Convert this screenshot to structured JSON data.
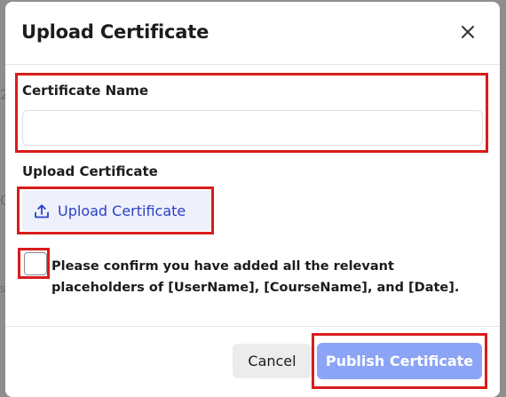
{
  "background": {
    "glyphs": [
      "2",
      "C",
      "s"
    ]
  },
  "modal": {
    "title": "Upload Certificate",
    "close_icon": "close-icon"
  },
  "form": {
    "certificate_name": {
      "label": "Certificate Name",
      "value": "",
      "placeholder": ""
    },
    "upload": {
      "label": "Upload Certificate",
      "button_label": "Upload Certificate",
      "icon": "upload-icon"
    },
    "confirm": {
      "checked": false,
      "text_prefix": "Please confirm you have added all the relevant placeholders of ",
      "ph_username": "[UserName]",
      "sep1": ", ",
      "ph_coursename": "[CourseName]",
      "sep2": ", and ",
      "ph_date": "[Date]",
      "end": "."
    }
  },
  "footer": {
    "cancel_label": "Cancel",
    "publish_label": "Publish Certificate"
  },
  "colors": {
    "highlight": "#d81c1c",
    "accent": "#2941c4",
    "publish_disabled": "#8ca4f6",
    "upload_bg": "#eef0fb"
  }
}
